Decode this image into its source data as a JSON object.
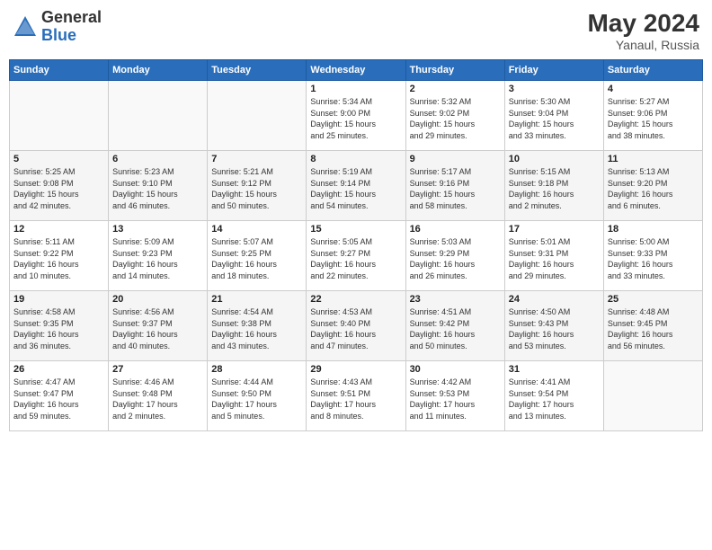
{
  "header": {
    "logo_general": "General",
    "logo_blue": "Blue",
    "month_year": "May 2024",
    "location": "Yanaul, Russia"
  },
  "days_of_week": [
    "Sunday",
    "Monday",
    "Tuesday",
    "Wednesday",
    "Thursday",
    "Friday",
    "Saturday"
  ],
  "weeks": [
    [
      {
        "num": "",
        "info": ""
      },
      {
        "num": "",
        "info": ""
      },
      {
        "num": "",
        "info": ""
      },
      {
        "num": "1",
        "info": "Sunrise: 5:34 AM\nSunset: 9:00 PM\nDaylight: 15 hours\nand 25 minutes."
      },
      {
        "num": "2",
        "info": "Sunrise: 5:32 AM\nSunset: 9:02 PM\nDaylight: 15 hours\nand 29 minutes."
      },
      {
        "num": "3",
        "info": "Sunrise: 5:30 AM\nSunset: 9:04 PM\nDaylight: 15 hours\nand 33 minutes."
      },
      {
        "num": "4",
        "info": "Sunrise: 5:27 AM\nSunset: 9:06 PM\nDaylight: 15 hours\nand 38 minutes."
      }
    ],
    [
      {
        "num": "5",
        "info": "Sunrise: 5:25 AM\nSunset: 9:08 PM\nDaylight: 15 hours\nand 42 minutes."
      },
      {
        "num": "6",
        "info": "Sunrise: 5:23 AM\nSunset: 9:10 PM\nDaylight: 15 hours\nand 46 minutes."
      },
      {
        "num": "7",
        "info": "Sunrise: 5:21 AM\nSunset: 9:12 PM\nDaylight: 15 hours\nand 50 minutes."
      },
      {
        "num": "8",
        "info": "Sunrise: 5:19 AM\nSunset: 9:14 PM\nDaylight: 15 hours\nand 54 minutes."
      },
      {
        "num": "9",
        "info": "Sunrise: 5:17 AM\nSunset: 9:16 PM\nDaylight: 15 hours\nand 58 minutes."
      },
      {
        "num": "10",
        "info": "Sunrise: 5:15 AM\nSunset: 9:18 PM\nDaylight: 16 hours\nand 2 minutes."
      },
      {
        "num": "11",
        "info": "Sunrise: 5:13 AM\nSunset: 9:20 PM\nDaylight: 16 hours\nand 6 minutes."
      }
    ],
    [
      {
        "num": "12",
        "info": "Sunrise: 5:11 AM\nSunset: 9:22 PM\nDaylight: 16 hours\nand 10 minutes."
      },
      {
        "num": "13",
        "info": "Sunrise: 5:09 AM\nSunset: 9:23 PM\nDaylight: 16 hours\nand 14 minutes."
      },
      {
        "num": "14",
        "info": "Sunrise: 5:07 AM\nSunset: 9:25 PM\nDaylight: 16 hours\nand 18 minutes."
      },
      {
        "num": "15",
        "info": "Sunrise: 5:05 AM\nSunset: 9:27 PM\nDaylight: 16 hours\nand 22 minutes."
      },
      {
        "num": "16",
        "info": "Sunrise: 5:03 AM\nSunset: 9:29 PM\nDaylight: 16 hours\nand 26 minutes."
      },
      {
        "num": "17",
        "info": "Sunrise: 5:01 AM\nSunset: 9:31 PM\nDaylight: 16 hours\nand 29 minutes."
      },
      {
        "num": "18",
        "info": "Sunrise: 5:00 AM\nSunset: 9:33 PM\nDaylight: 16 hours\nand 33 minutes."
      }
    ],
    [
      {
        "num": "19",
        "info": "Sunrise: 4:58 AM\nSunset: 9:35 PM\nDaylight: 16 hours\nand 36 minutes."
      },
      {
        "num": "20",
        "info": "Sunrise: 4:56 AM\nSunset: 9:37 PM\nDaylight: 16 hours\nand 40 minutes."
      },
      {
        "num": "21",
        "info": "Sunrise: 4:54 AM\nSunset: 9:38 PM\nDaylight: 16 hours\nand 43 minutes."
      },
      {
        "num": "22",
        "info": "Sunrise: 4:53 AM\nSunset: 9:40 PM\nDaylight: 16 hours\nand 47 minutes."
      },
      {
        "num": "23",
        "info": "Sunrise: 4:51 AM\nSunset: 9:42 PM\nDaylight: 16 hours\nand 50 minutes."
      },
      {
        "num": "24",
        "info": "Sunrise: 4:50 AM\nSunset: 9:43 PM\nDaylight: 16 hours\nand 53 minutes."
      },
      {
        "num": "25",
        "info": "Sunrise: 4:48 AM\nSunset: 9:45 PM\nDaylight: 16 hours\nand 56 minutes."
      }
    ],
    [
      {
        "num": "26",
        "info": "Sunrise: 4:47 AM\nSunset: 9:47 PM\nDaylight: 16 hours\nand 59 minutes."
      },
      {
        "num": "27",
        "info": "Sunrise: 4:46 AM\nSunset: 9:48 PM\nDaylight: 17 hours\nand 2 minutes."
      },
      {
        "num": "28",
        "info": "Sunrise: 4:44 AM\nSunset: 9:50 PM\nDaylight: 17 hours\nand 5 minutes."
      },
      {
        "num": "29",
        "info": "Sunrise: 4:43 AM\nSunset: 9:51 PM\nDaylight: 17 hours\nand 8 minutes."
      },
      {
        "num": "30",
        "info": "Sunrise: 4:42 AM\nSunset: 9:53 PM\nDaylight: 17 hours\nand 11 minutes."
      },
      {
        "num": "31",
        "info": "Sunrise: 4:41 AM\nSunset: 9:54 PM\nDaylight: 17 hours\nand 13 minutes."
      },
      {
        "num": "",
        "info": ""
      }
    ]
  ]
}
